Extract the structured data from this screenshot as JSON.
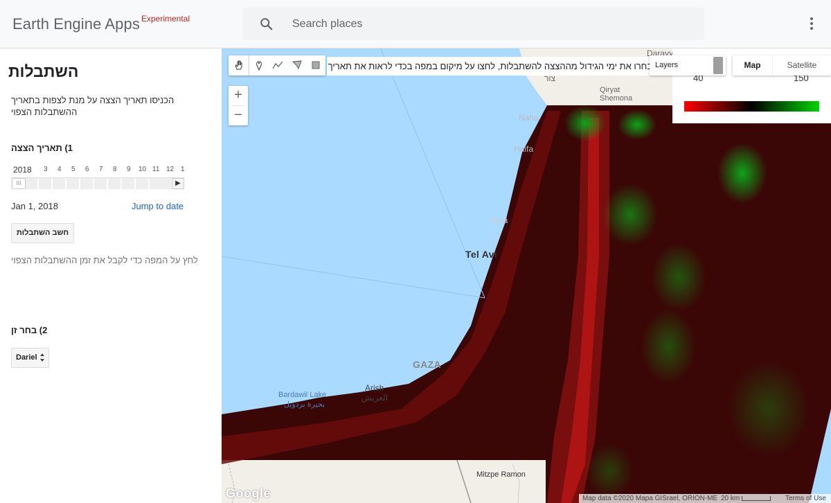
{
  "header": {
    "logo": "Earth Engine Apps",
    "logo_tag": "Experimental",
    "search_placeholder": "Search places"
  },
  "panel": {
    "title": "השתבלות",
    "description": "הכניסו תאריך הצצה על מנת לצפות בתאריך ההשתבלות הצפוי",
    "section1_title": "1) תאריך הצצה",
    "slider": {
      "year": "2018",
      "ticks": [
        "3",
        "4",
        "5",
        "6",
        "7",
        "8",
        "9",
        "10",
        "11",
        "12",
        "1"
      ],
      "thumb": "III",
      "play": "▶"
    },
    "date_value": "Jan 1, 2018",
    "jump_link": "Jump to date",
    "calc_button": "חשב השתבלות",
    "hint": "לחץ על המפה כדי לקבל את זמן ההשתבלות הצפוי",
    "section2_title": "2) בחר זן",
    "variety_select": "Dariel"
  },
  "map": {
    "banner": "בחרו את ימי הגידול מההצצה להשתבלות, לחצו על מיקום במפה בכדי לראות את תאריך",
    "zoom_in": "+",
    "zoom_out": "−",
    "layers_label": "Layers",
    "legend": {
      "min": "40",
      "max": "150",
      "colors": [
        "#ff0000",
        "#000000",
        "#00d500"
      ]
    },
    "map_type": {
      "map": "Map",
      "satellite": "Satellite"
    },
    "places": {
      "daravya": "Darayya",
      "qiryat_shemona": "Qiryat Shemona",
      "tsur": "צור",
      "nahariya": "Naha",
      "haifa": "Haifa",
      "netanya": "Neta",
      "tel_aviv": "Tel Avi",
      "gaza": "GAZA",
      "arish": "Arish",
      "arish_ar": "العريش",
      "bardawil": "Bardawil Lake",
      "bardawil_ar": "بحيرة بردويل",
      "mitzpe_ramon": "Mitzpe Ramon"
    },
    "google": "Google",
    "attribution": "Map data ©2020 Mapa GISrael, ORION-ME",
    "scale": "20 km",
    "terms": "Terms of Use"
  }
}
